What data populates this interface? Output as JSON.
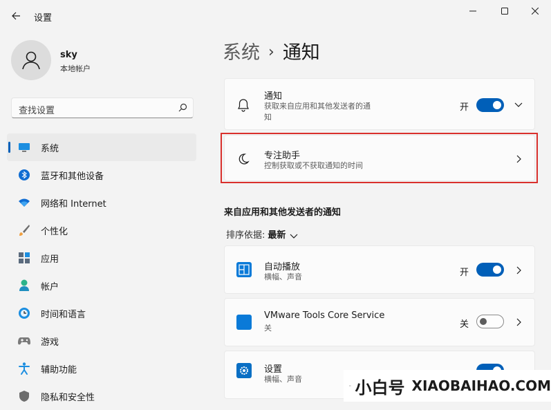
{
  "window": {
    "title": "设置",
    "back_icon": "arrow-left-icon",
    "controls": [
      "minimize",
      "maximize",
      "close"
    ]
  },
  "user": {
    "name": "sky",
    "account_type": "本地帐户"
  },
  "search": {
    "placeholder": "查找设置"
  },
  "sidebar": {
    "items": [
      {
        "label": "系统",
        "icon": "system-icon",
        "selected": true
      },
      {
        "label": "蓝牙和其他设备",
        "icon": "bluetooth-icon",
        "selected": false
      },
      {
        "label": "网络和 Internet",
        "icon": "network-icon",
        "selected": false
      },
      {
        "label": "个性化",
        "icon": "brush-icon",
        "selected": false
      },
      {
        "label": "应用",
        "icon": "apps-icon",
        "selected": false
      },
      {
        "label": "帐户",
        "icon": "account-icon",
        "selected": false
      },
      {
        "label": "时间和语言",
        "icon": "time-language-icon",
        "selected": false
      },
      {
        "label": "游戏",
        "icon": "gamepad-icon",
        "selected": false
      },
      {
        "label": "辅助功能",
        "icon": "accessibility-icon",
        "selected": false
      },
      {
        "label": "隐私和安全性",
        "icon": "shield-icon",
        "selected": false
      }
    ]
  },
  "breadcrumb": {
    "parent": "系统",
    "separator": "›",
    "current": "通知"
  },
  "notifications_card": {
    "title": "通知",
    "description_line1": "获取来自应用和其他发送者的通",
    "description_line2": "知",
    "toggle_label": "开",
    "toggle_on": true
  },
  "focus_assist_card": {
    "title": "专注助手",
    "description": "控制获取或不获取通知的时间",
    "highlighted": true
  },
  "apps_section": {
    "title": "来自应用和其他发送者的通知",
    "sort_label": "排序依据:",
    "sort_value": "最新"
  },
  "app_rows": [
    {
      "title": "自动播放",
      "description": "横幅、声音",
      "toggle_label": "开",
      "toggle_on": true,
      "icon": "autoplay-icon"
    },
    {
      "title": "VMware Tools Core Service",
      "description": "关",
      "toggle_label": "关",
      "toggle_on": false,
      "icon": "vmware-icon"
    },
    {
      "title": "设置",
      "description": "横幅、声音",
      "toggle_on": true,
      "icon": "settings-gear-icon"
    }
  ],
  "watermark": {
    "cn": "小白号",
    "en": "XIAOBAIHAO.COM"
  },
  "colors": {
    "accent": "#005fb8",
    "highlight_border": "#d9302c",
    "background": "#f3f3f3",
    "card": "#fbfbfb"
  }
}
